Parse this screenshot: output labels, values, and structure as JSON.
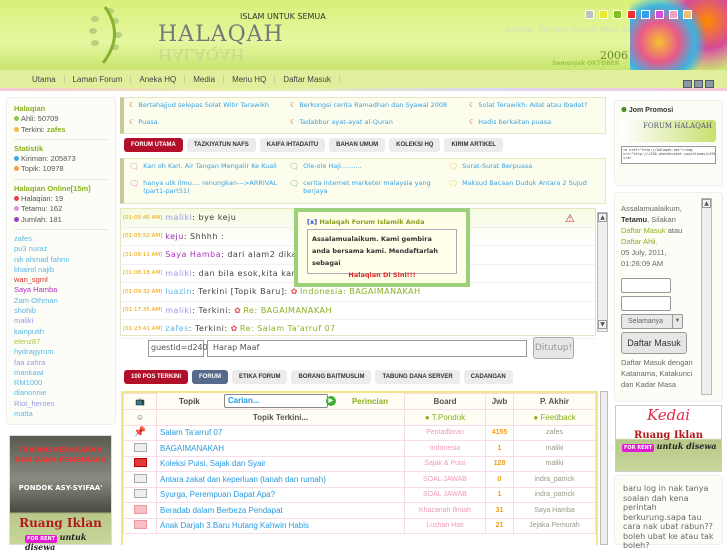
{
  "header": {
    "slogan": "ISLAM UNTUK SEMUA",
    "logo": "HALAQAH",
    "berita": "Berita: Terima Kasih Atas Sokongan Anda",
    "year": "2006",
    "since": "Semenjak OKTOBER",
    "theme_colors": [
      "#c0c0c0",
      "#e8e830",
      "#80c020",
      "#f03030",
      "#30a0f0",
      "#d050e0",
      "#f0a0c0",
      "#f0c070"
    ]
  },
  "nav": [
    "Utama",
    "Laman Forum",
    "Aneka HQ",
    "Media",
    "Menu HQ",
    "Daftar Masuk"
  ],
  "left": {
    "halaqian_title": "Halaqian",
    "ahli": "Ahli: 50709",
    "terkini_label": "Terkini: ",
    "terkini_user": "zafes",
    "stat_title": "Statistik",
    "kiriman": "Kiriman: 205873",
    "topik": "Topik: 10978",
    "online_title": "Halaqian Online[15m]",
    "halaqian": "Halaqian: 19",
    "tetamu": "Tetamu: 162",
    "jumlah": "Jumlah: 181",
    "users": [
      {
        "n": "zafes",
        "c": "#5ab8e8"
      },
      {
        "n": "pu3 nuraz",
        "c": "#5ab8e8"
      },
      {
        "n": "nik ahmad fahmi",
        "c": "#5ab8e8"
      },
      {
        "n": "khairol najib",
        "c": "#5ab8e8"
      },
      {
        "n": "wan_sgml",
        "c": "#e03030"
      },
      {
        "n": "Saya Hamba",
        "c": "#b030c0"
      },
      {
        "n": "Zam Othman",
        "c": "#5ab8e8"
      },
      {
        "n": "shohib",
        "c": "#5ab8e8"
      },
      {
        "n": "maliki",
        "c": "#9a9ae0"
      },
      {
        "n": "kainputih",
        "c": "#5ab8e8"
      },
      {
        "n": "elenz87",
        "c": "#a8c840"
      },
      {
        "n": "hydragyrum",
        "c": "#5ab8e8"
      },
      {
        "n": "faa zahra",
        "c": "#9a9ae0"
      },
      {
        "n": "mankawi",
        "c": "#5ab8e8"
      },
      {
        "n": "RM1000",
        "c": "#5ab8e8"
      },
      {
        "n": "dianonnie",
        "c": "#5ab8e8"
      },
      {
        "n": "Riot_heroes",
        "c": "#9a9ae0"
      },
      {
        "n": "matta",
        "c": "#5ab8e8"
      }
    ],
    "ad": {
      "line1": "TABUNG KEBAKARAN",
      "line2": "DAN DANA PEMBINAAN",
      "line3": "PONDOK ASY-SYIFAA'",
      "ruang": "Ruang Iklan",
      "forrent": "FOR RENT",
      "disewa": "untuk disewa"
    }
  },
  "news": [
    "Bertahajjud selepas Solat Witir Tarawikh",
    "Berkongsi cerita Ramadhan dan Syawal 2008",
    "Solat Terawikh: Adat atau Ibadat?",
    "Puasa.",
    "Tadabbur ayat-ayat al-Quran",
    "Hadis berkaitan puasa"
  ],
  "tabs1": [
    "FORUM UTAMA",
    "TAZKIYATUN NAFS",
    "KAIFA IHTADAITU",
    "BAHAN UMUM",
    "KOLEKSI HQ",
    "KIRIM ARTIKEL"
  ],
  "topics": [
    {
      "t": "Kari oh Kari, Air Tangan Mengalir Ke Kuali",
      "c": "#e070d0"
    },
    {
      "t": "Ole-ole Haji..........",
      "c": "#60c050"
    },
    {
      "t": "Surat-Surat Berpuasa",
      "c": "#e0d030"
    },
    {
      "t": "hanya utk ilmu.... renungkan--->ARRIVAL (part1-part51)",
      "c": "#e070d0"
    },
    {
      "t": "cerita internet marketer malaysia yang berjaya",
      "c": "#60c050"
    },
    {
      "t": "Maksud Bacaan Duduk Antara 2 Sujud",
      "c": "#e0d030"
    }
  ],
  "shoutbox": {
    "lines": [
      {
        "time": "[01:05:46 AM]",
        "user": "maliki",
        "uc": "#9a9ae0",
        "msg": ": bye keju",
        "link": ""
      },
      {
        "time": "[01:05:52 AM]",
        "user": "keju",
        "uc": "#9030b0",
        "msg": ": Shhhh :",
        "link": ""
      },
      {
        "time": "[01:06:11 AM]",
        "user": "Saya Hamba",
        "uc": "#b030c0",
        "msg": ": dari alam2 dika",
        "link": ""
      },
      {
        "time": "[01:08:18 AM]",
        "user": "maliki",
        "uc": "#9a9ae0",
        "msg": ": dan bila esok,kita kan",
        "link": ""
      },
      {
        "time": "[01:09:32 AM]",
        "user": "luazin",
        "uc": "#5ab8e8",
        "msg": ": Terkini [Topik Baru]: ",
        "link": "Indonesia: BAGAIMANAKAH"
      },
      {
        "time": "[01:17:35 AM]",
        "user": "maliki",
        "uc": "#9a9ae0",
        "msg": ": Terkini: ",
        "link": "Re: BAGAIMANAKAH"
      },
      {
        "time": "[01:23:41 AM]",
        "user": "zafes",
        "uc": "#5ab8e8",
        "msg": ": Terkini: ",
        "link": "Re: Salam Ta'arruf 07"
      }
    ],
    "guest": "guestid=d240",
    "message": "Harap Maaf",
    "button": "Ditutup!"
  },
  "popup": {
    "close": "[x]",
    "title": "Halaqah Forum Islamik  Anda",
    "body": "Assalamualaikum. Kami gembira anda bersama kami. Mendaftarlah sebagai",
    "cta": "Halaqian Di Sini!!!"
  },
  "tabs2": [
    "100 POS TERKINI",
    "FORUM",
    "ETIKA FORUM",
    "BORANG BAITMUSLIM",
    "TABUNG DANA SERVER",
    "CADANGAN"
  ],
  "table": {
    "h_topik": "Topik",
    "search_placeholder": "Carian...",
    "h_perincian": "Perincian",
    "h_board": "Board",
    "h_jwb": "Jwb",
    "h_akhir": "P. Akhir",
    "latest": "Topik Terkini...",
    "pondok": "T.Pondok",
    "feedback": "Feedback",
    "rows": [
      {
        "icon": "pin",
        "t": "Salam Ta'arruf 07",
        "b": "Pentadbiran",
        "j": "4155",
        "a": "zafes"
      },
      {
        "icon": "grey",
        "t": "BAGAIMANAKAH",
        "b": "Indonesia",
        "j": "1",
        "a": "maliki"
      },
      {
        "icon": "red",
        "t": "Koleksi Puisi, Sajak dan Syair",
        "b": "Sajak & Puisi",
        "j": "128",
        "a": "maliki"
      },
      {
        "icon": "grey",
        "t": "Antara zakat dan keperluan (tanah dan rumah)",
        "b": "SOAL JAWAB",
        "j": "0",
        "a": "indra_patrick"
      },
      {
        "icon": "grey",
        "t": "Syurga, Perempuan Dapat Apa?",
        "b": "SOAL JAWAB",
        "j": "1",
        "a": "indra_patrick"
      },
      {
        "icon": "pink",
        "t": "Beradab dalam Berbeza Pendapat",
        "b": "Khazanah Ilmiah",
        "j": "31",
        "a": "Saya Hamba"
      },
      {
        "icon": "pink",
        "t": "Anak Darjah 3.Baru Hutang Kahwin Habis",
        "b": "Lushan Hati",
        "j": "21",
        "a": "Jejaka Pemurah"
      }
    ]
  },
  "right": {
    "promo_title": "Jom Promosi",
    "promo_banner": "FORUM HALAQAH",
    "promo_code": "<a href=\"http://halaqah.net\"><img src=\"http://i336.photobucket.com/albums/n330/halaqah/halaqa.png\"></a>",
    "login": {
      "greet": "Assalamualaikum,",
      "tetamu": "Tetamu",
      "silakan": ", Silakan",
      "daftar_masuk": "Daftar Masuk",
      "atau": " atau",
      "daftar_ahli": "Daftar Ahli.",
      "date": "05 July, 2011, 01:26:09 AM",
      "duration": "Selamanya",
      "button": "Daftar Masuk",
      "hint": "Daftar Masuk dengan Katanama, Katakunci dan Kadar Masa"
    },
    "kedai": {
      "title": "Kedai",
      "ruang": "Ruang Iklan",
      "forrent": "FOR RENT",
      "disewa": "untuk disewa"
    },
    "shout": "baru log in nak tanya soalan dah kena perintah berkurung.sapa tau cara nak ubat rabun??boleh ubat ke atau tak boleh?"
  }
}
